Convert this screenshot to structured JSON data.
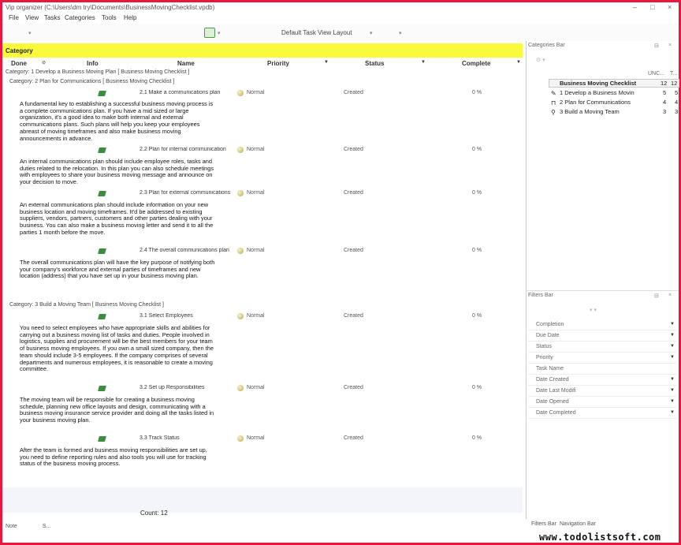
{
  "window": {
    "title": "Vip organizer (C:\\Users\\dm try\\Documents\\BusinessMovingChecklist.vpdb)",
    "min": "–",
    "max": "□",
    "close": "×"
  },
  "menu": [
    "File",
    "View",
    "Tasks",
    "Categories",
    "Tools",
    "Help"
  ],
  "toolbar": {
    "view_layout": "Default Task View Layout"
  },
  "category_bar": {
    "label": "Category"
  },
  "columns": {
    "done": "Done",
    "info": "Info",
    "name": "Name",
    "priority": "Priority",
    "status": "Status",
    "complete": "Complete"
  },
  "categories": [
    {
      "line": "Category: 1 Develop a Business Moving Plan    [ Business Moving Checklist ]"
    },
    {
      "line": "Category: 2 Plan for Communications    [ Business Moving Checklist ]"
    },
    {
      "line": "Category: 3 Build a Moving Team    [ Business Moving Checklist ]"
    }
  ],
  "tasks": [
    {
      "name": "2.1 Make a communications plan",
      "priority": "Normal",
      "status": "Created",
      "complete": "0 %",
      "desc": "A fundamental key to establishing a successful business moving process is a complete communications plan. If you have a mid sized or large organization, it's a good idea to make both internal and external communications plans. Such plans will help you keep your employees abreast of moving timeframes and also make business moving announcements in advance."
    },
    {
      "name": "2.2 Plan for internal communication",
      "priority": "Normal",
      "status": "Created",
      "complete": "0 %",
      "desc": "An internal communications plan should include employee roles, tasks and duties related to the relocation. In this plan you can also schedule meetings with employees to share your business moving message and announce on your decision to move."
    },
    {
      "name": "2.3 Plan for external communications",
      "priority": "Normal",
      "status": "Created",
      "complete": "0 %",
      "desc": "An external communications plan should include information on your new business location and moving timeframes. It'd be addressed to existing suppliers, vendors, partners, customers and other parties dealing with your business. You can also make a business moving letter and send it to all the parties 1 month before the move."
    },
    {
      "name": "2.4 The overall communications plan",
      "priority": "Normal",
      "status": "Created",
      "complete": "0 %",
      "desc": "The overall communications plan will have the key purpose of notifying both your company's workforce and external parties of timeframes and new location (address) that you have set up in your business moving plan."
    },
    {
      "name": "3.1 Select Employees",
      "priority": "Normal",
      "status": "Created",
      "complete": "0 %",
      "desc": "You need to select employees who have appropriate skills and abilities for carrying out a business moving list of tasks and duties. People involved in logistics, supplies and procurement will be the best members for your team of business moving employees. If you own a small sized company, then the team should include 3-5 employees. If the company comprises of several departments and numerous employees, it is reasonable to create a moving committee."
    },
    {
      "name": "3.2 Set up Responsibilities",
      "priority": "Normal",
      "status": "Created",
      "complete": "0 %",
      "desc": "The moving team will be responsible for creating a business moving schedule, planning new office layouts and design, communicating with a business moving insurance service provider and doing all the tasks listed in your business moving plan."
    },
    {
      "name": "3.3 Track Status",
      "priority": "Normal",
      "status": "Created",
      "complete": "0 %",
      "desc": "After the team is formed and business moving responsibilities are set up, you need to define reporting rules and also tools you will use for tracking status of the business moving process."
    }
  ],
  "footer": {
    "count": "Count: 12",
    "note": "Note",
    "s": "S..."
  },
  "categories_panel": {
    "title": "Categories Bar",
    "col_a": "UNC...",
    "col_b": "T...",
    "items": [
      {
        "name": "Business Moving Checklist",
        "a": "12",
        "b": "12"
      },
      {
        "name": "1 Develop a Business Movin",
        "a": "5",
        "b": "5"
      },
      {
        "name": "2 Plan for Communications",
        "a": "4",
        "b": "4"
      },
      {
        "name": "3 Build a Moving Team",
        "a": "3",
        "b": "3"
      }
    ]
  },
  "filters_panel": {
    "title": "Filters Bar",
    "rows": [
      "Completion",
      "Due Date",
      "Status",
      "Priority",
      "Task Name",
      "Date Created",
      "Date Last Modifi",
      "Date Opened",
      "Date Completed"
    ]
  },
  "panel_tabs": [
    "Filters Bar",
    "Navigation Bar"
  ],
  "watermark": "www.todolistsoft.com"
}
